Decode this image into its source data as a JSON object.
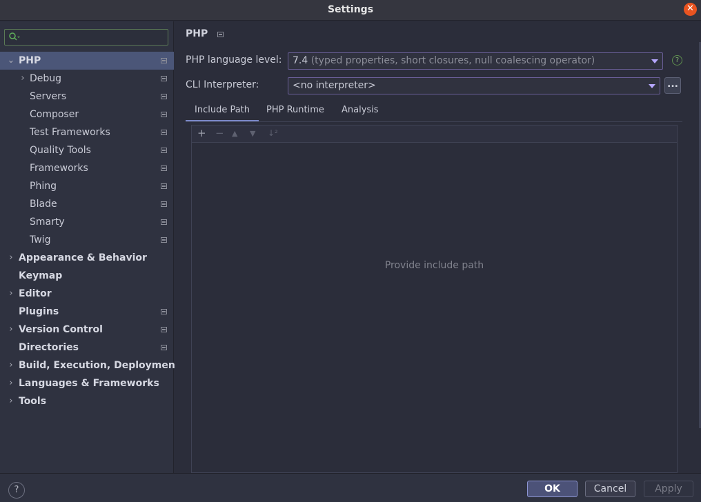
{
  "window": {
    "title": "Settings"
  },
  "sidebar": {
    "search_placeholder": "",
    "items": [
      {
        "label": "PHP",
        "arrow": "⌄",
        "selected": true,
        "bold": true,
        "project": true
      },
      {
        "label": "Debug",
        "arrow": "›",
        "project": true
      },
      {
        "label": "Servers",
        "project": true
      },
      {
        "label": "Composer",
        "project": true
      },
      {
        "label": "Test Frameworks",
        "project": true
      },
      {
        "label": "Quality Tools",
        "project": true
      },
      {
        "label": "Frameworks",
        "project": true
      },
      {
        "label": "Phing",
        "project": true
      },
      {
        "label": "Blade",
        "project": true
      },
      {
        "label": "Smarty",
        "project": true
      },
      {
        "label": "Twig",
        "project": true
      },
      {
        "label": "Appearance & Behavior",
        "arrow": "›",
        "bold": true
      },
      {
        "label": "Keymap",
        "bold": true
      },
      {
        "label": "Editor",
        "arrow": "›",
        "bold": true
      },
      {
        "label": "Plugins",
        "bold": true,
        "project": true
      },
      {
        "label": "Version Control",
        "arrow": "›",
        "bold": true,
        "project": true
      },
      {
        "label": "Directories",
        "bold": true,
        "project": true
      },
      {
        "label": "Build, Execution, Deployment",
        "arrow": "›",
        "bold": true
      },
      {
        "label": "Languages & Frameworks",
        "arrow": "›",
        "bold": true
      },
      {
        "label": "Tools",
        "arrow": "›",
        "bold": true
      }
    ]
  },
  "main": {
    "breadcrumb": "PHP",
    "language_level_label": "PHP language level:",
    "language_level_value": "7.4",
    "language_level_desc": "(typed properties, short closures, null coalescing operator)",
    "cli_label": "CLI Interpreter:",
    "cli_value": "<no interpreter>",
    "browse_label": "...",
    "tabs": [
      "Include Path",
      "PHP Runtime",
      "Analysis"
    ],
    "empty_text": "Provide include path"
  },
  "footer": {
    "help": "?",
    "ok": "OK",
    "cancel": "Cancel",
    "apply": "Apply"
  },
  "colors": {
    "accent": "#4b5678",
    "close": "#e95420",
    "combo_border": "#6a5f98"
  }
}
